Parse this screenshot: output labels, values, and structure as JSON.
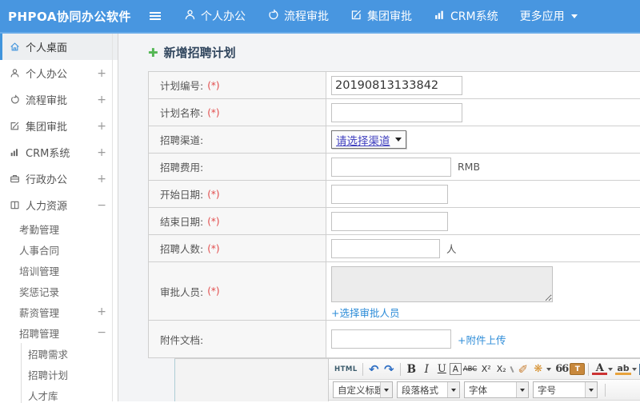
{
  "colors": {
    "header_blue": "#4896e0",
    "accent_blue": "#4094dc",
    "link_blue": "#2d8cd8",
    "required_red": "#e24b4b",
    "plus_green": "#54b754",
    "select_text_blue": "#4040bf"
  },
  "header": {
    "logo": "PHPOA协同办公软件",
    "nav": [
      {
        "label": "个人办公",
        "icon": "user-icon"
      },
      {
        "label": "流程审批",
        "icon": "flow-icon"
      },
      {
        "label": "集团审批",
        "icon": "edit-icon"
      },
      {
        "label": "CRM系统",
        "icon": "chart-icon"
      },
      {
        "label": "更多应用",
        "icon": "caret-down-icon"
      }
    ]
  },
  "sidebar": {
    "items": [
      {
        "label": "个人桌面",
        "icon": "home-icon",
        "active": true
      },
      {
        "label": "个人办公",
        "icon": "user-icon",
        "expander": "+"
      },
      {
        "label": "流程审批",
        "icon": "flow-icon",
        "expander": "+"
      },
      {
        "label": "集团审批",
        "icon": "edit-icon",
        "expander": "+"
      },
      {
        "label": "CRM系统",
        "icon": "chart-icon",
        "expander": "+"
      },
      {
        "label": "行政办公",
        "icon": "briefcase-icon",
        "expander": "+"
      },
      {
        "label": "人力资源",
        "icon": "book-icon",
        "expander": "−"
      },
      {
        "label": "考勤管理"
      },
      {
        "label": "人事合同"
      },
      {
        "label": "培训管理"
      },
      {
        "label": "奖惩记录"
      },
      {
        "label": "薪资管理",
        "expander": "+"
      },
      {
        "label": "招聘管理",
        "expander": "−"
      },
      {
        "label": "招聘需求"
      },
      {
        "label": "招聘计划"
      },
      {
        "label": "人才库"
      }
    ]
  },
  "main": {
    "title": "新增招聘计划",
    "form": {
      "rows": [
        {
          "label": "计划编号:",
          "required": "(*)",
          "value": "20190813133842"
        },
        {
          "label": "计划名称:",
          "required": "(*)",
          "value": ""
        },
        {
          "label": "招聘渠道:",
          "select_value": "请选择渠道"
        },
        {
          "label": "招聘费用:",
          "value": "",
          "suffix": "RMB"
        },
        {
          "label": "开始日期:",
          "required": "(*)",
          "value": ""
        },
        {
          "label": "结束日期:",
          "required": "(*)",
          "value": ""
        },
        {
          "label": "招聘人数:",
          "required": "(*)",
          "value": "",
          "suffix": "人"
        },
        {
          "label": "审批人员:",
          "required": "(*)",
          "link": "+选择审批人员"
        },
        {
          "label": "附件文档:",
          "value": "",
          "link": "+附件上传"
        }
      ]
    },
    "editor": {
      "html_btn": "HTML",
      "bold": "B",
      "italic": "I",
      "underline": "U",
      "font_box": "A",
      "strike": "ABC",
      "superscript": "X²",
      "subscript": "X₂",
      "quote": "66",
      "paste_t": "T",
      "font_color": "A",
      "highlight": "ab",
      "selects": {
        "custom_title": "自定义标题",
        "paragraph": "段落格式",
        "font_family": "字体",
        "font_size": "字号"
      }
    }
  }
}
